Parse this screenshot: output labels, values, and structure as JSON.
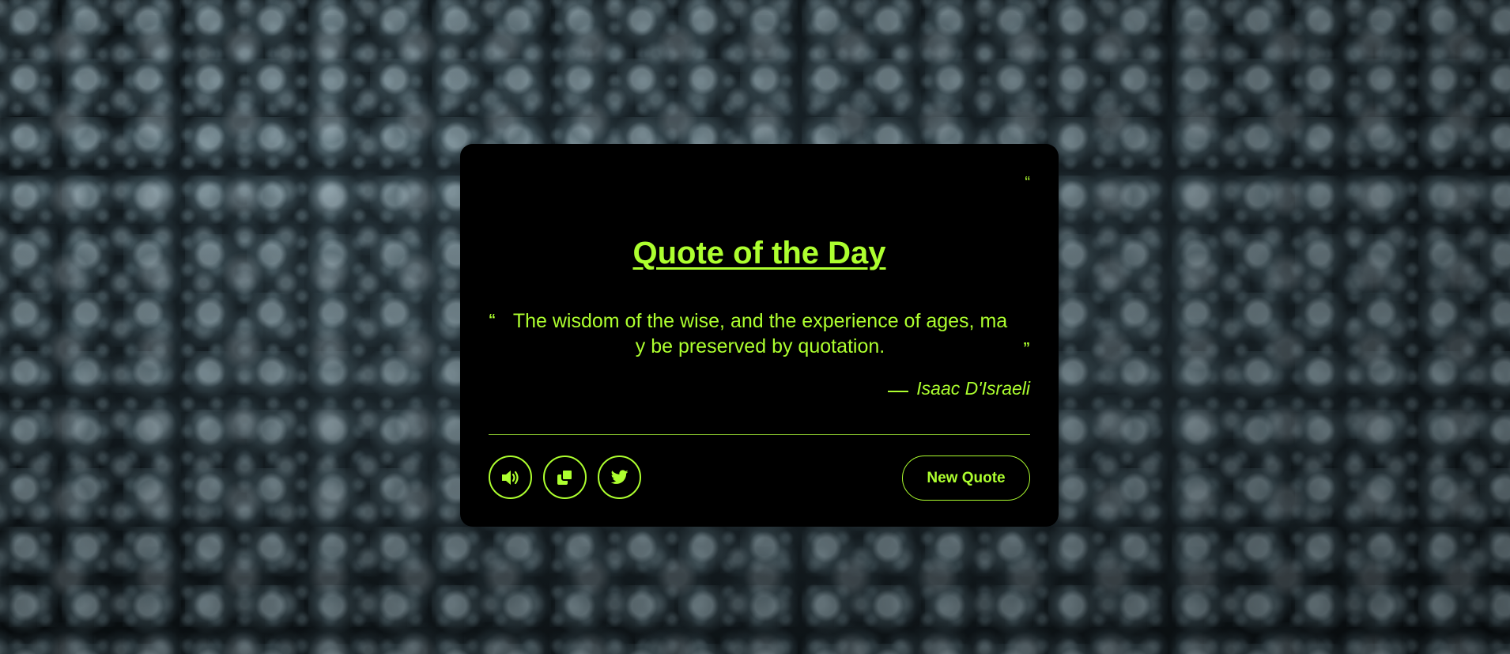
{
  "card": {
    "corner_mark": "“",
    "title": "Quote of the Day",
    "quote": {
      "open_mark": "“",
      "text": "The wisdom of the wise, and the experience of ages, may be preserved by quotation.",
      "close_mark": "”"
    },
    "author": "Isaac D'Israeli"
  },
  "actions": {
    "speak_icon": "volume-icon",
    "copy_icon": "copy-icon",
    "twitter_icon": "twitter-icon",
    "new_quote_label": "New Quote"
  },
  "colors": {
    "accent": "#adff2f",
    "card_background": "#000000"
  }
}
